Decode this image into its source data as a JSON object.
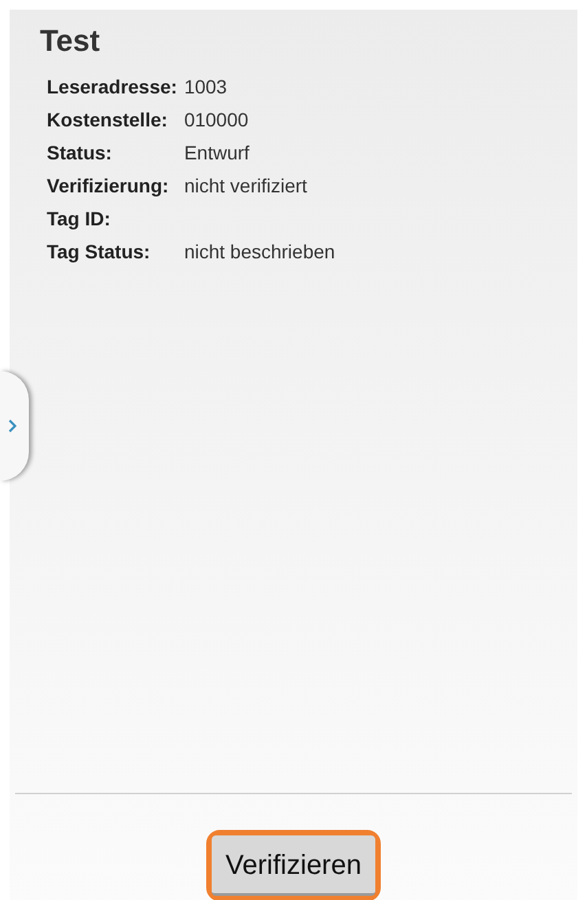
{
  "title": "Test",
  "fields": [
    {
      "label": "Leseradresse:",
      "value": "1003"
    },
    {
      "label": "Kostenstelle:",
      "value": "010000"
    },
    {
      "label": "Status:",
      "value": "Entwurf"
    },
    {
      "label": "Verifizierung:",
      "value": "nicht verifiziert"
    },
    {
      "label": "Tag ID:"
    },
    {
      "label": "Tag Status:",
      "value": "nicht beschrieben"
    }
  ],
  "button": {
    "label": "Verifizieren",
    "focused": true
  }
}
